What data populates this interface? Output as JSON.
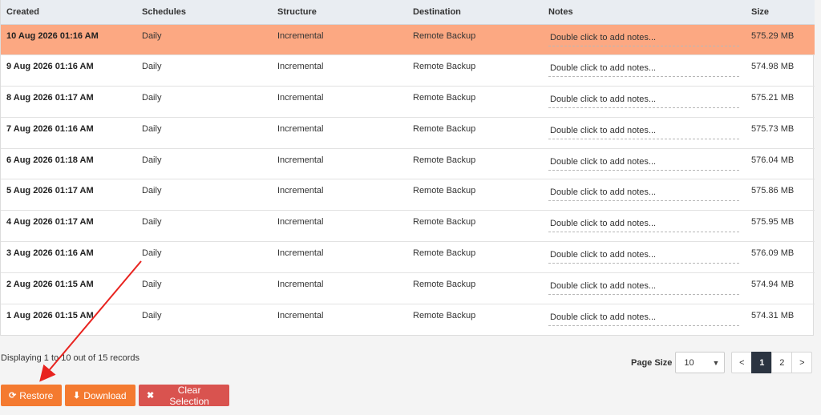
{
  "table": {
    "columns": [
      "Created",
      "Schedules",
      "Structure",
      "Destination",
      "Notes",
      "Size"
    ],
    "rows": [
      {
        "created": "10 Aug 2026 01:16 AM",
        "schedule": "Daily",
        "structure": "Incremental",
        "destination": "Remote Backup",
        "notes": "Double click to add notes...",
        "size": "575.29 MB"
      },
      {
        "created": "9 Aug 2026 01:16 AM",
        "schedule": "Daily",
        "structure": "Incremental",
        "destination": "Remote Backup",
        "notes": "Double click to add notes...",
        "size": "574.98 MB"
      },
      {
        "created": "8 Aug 2026 01:17 AM",
        "schedule": "Daily",
        "structure": "Incremental",
        "destination": "Remote Backup",
        "notes": "Double click to add notes...",
        "size": "575.21 MB"
      },
      {
        "created": "7 Aug 2026 01:16 AM",
        "schedule": "Daily",
        "structure": "Incremental",
        "destination": "Remote Backup",
        "notes": "Double click to add notes...",
        "size": "575.73 MB"
      },
      {
        "created": "6 Aug 2026 01:18 AM",
        "schedule": "Daily",
        "structure": "Incremental",
        "destination": "Remote Backup",
        "notes": "Double click to add notes...",
        "size": "576.04 MB"
      },
      {
        "created": "5 Aug 2026 01:17 AM",
        "schedule": "Daily",
        "structure": "Incremental",
        "destination": "Remote Backup",
        "notes": "Double click to add notes...",
        "size": "575.86 MB"
      },
      {
        "created": "4 Aug 2026 01:17 AM",
        "schedule": "Daily",
        "structure": "Incremental",
        "destination": "Remote Backup",
        "notes": "Double click to add notes...",
        "size": "575.95 MB"
      },
      {
        "created": "3 Aug 2026 01:16 AM",
        "schedule": "Daily",
        "structure": "Incremental",
        "destination": "Remote Backup",
        "notes": "Double click to add notes...",
        "size": "576.09 MB"
      },
      {
        "created": "2 Aug 2026 01:15 AM",
        "schedule": "Daily",
        "structure": "Incremental",
        "destination": "Remote Backup",
        "notes": "Double click to add notes...",
        "size": "574.94 MB"
      },
      {
        "created": "1 Aug 2026 01:15 AM",
        "schedule": "Daily",
        "structure": "Incremental",
        "destination": "Remote Backup",
        "notes": "Double click to add notes...",
        "size": "574.31 MB"
      }
    ],
    "selected_row": 0
  },
  "footer": {
    "records_info": "Displaying 1 to 10 out of 15 records",
    "page_size_label": "Page Size",
    "page_size_value": "10",
    "pages": [
      "<",
      "1",
      "2",
      ">"
    ],
    "active_page": "1"
  },
  "actions": {
    "restore_label": "Restore",
    "restore_icon": "refresh-icon",
    "download_label": "Download",
    "download_icon": "download-icon",
    "clear_label": "Clear Selection",
    "clear_icon": "close-icon"
  },
  "colors": {
    "selected_row": "#fca882",
    "header_bg": "#e9edf2",
    "primary_button": "#f47a30",
    "danger_button": "#d9534f",
    "active_page": "#2b3441",
    "annotation_arrow": "#e8231f"
  }
}
